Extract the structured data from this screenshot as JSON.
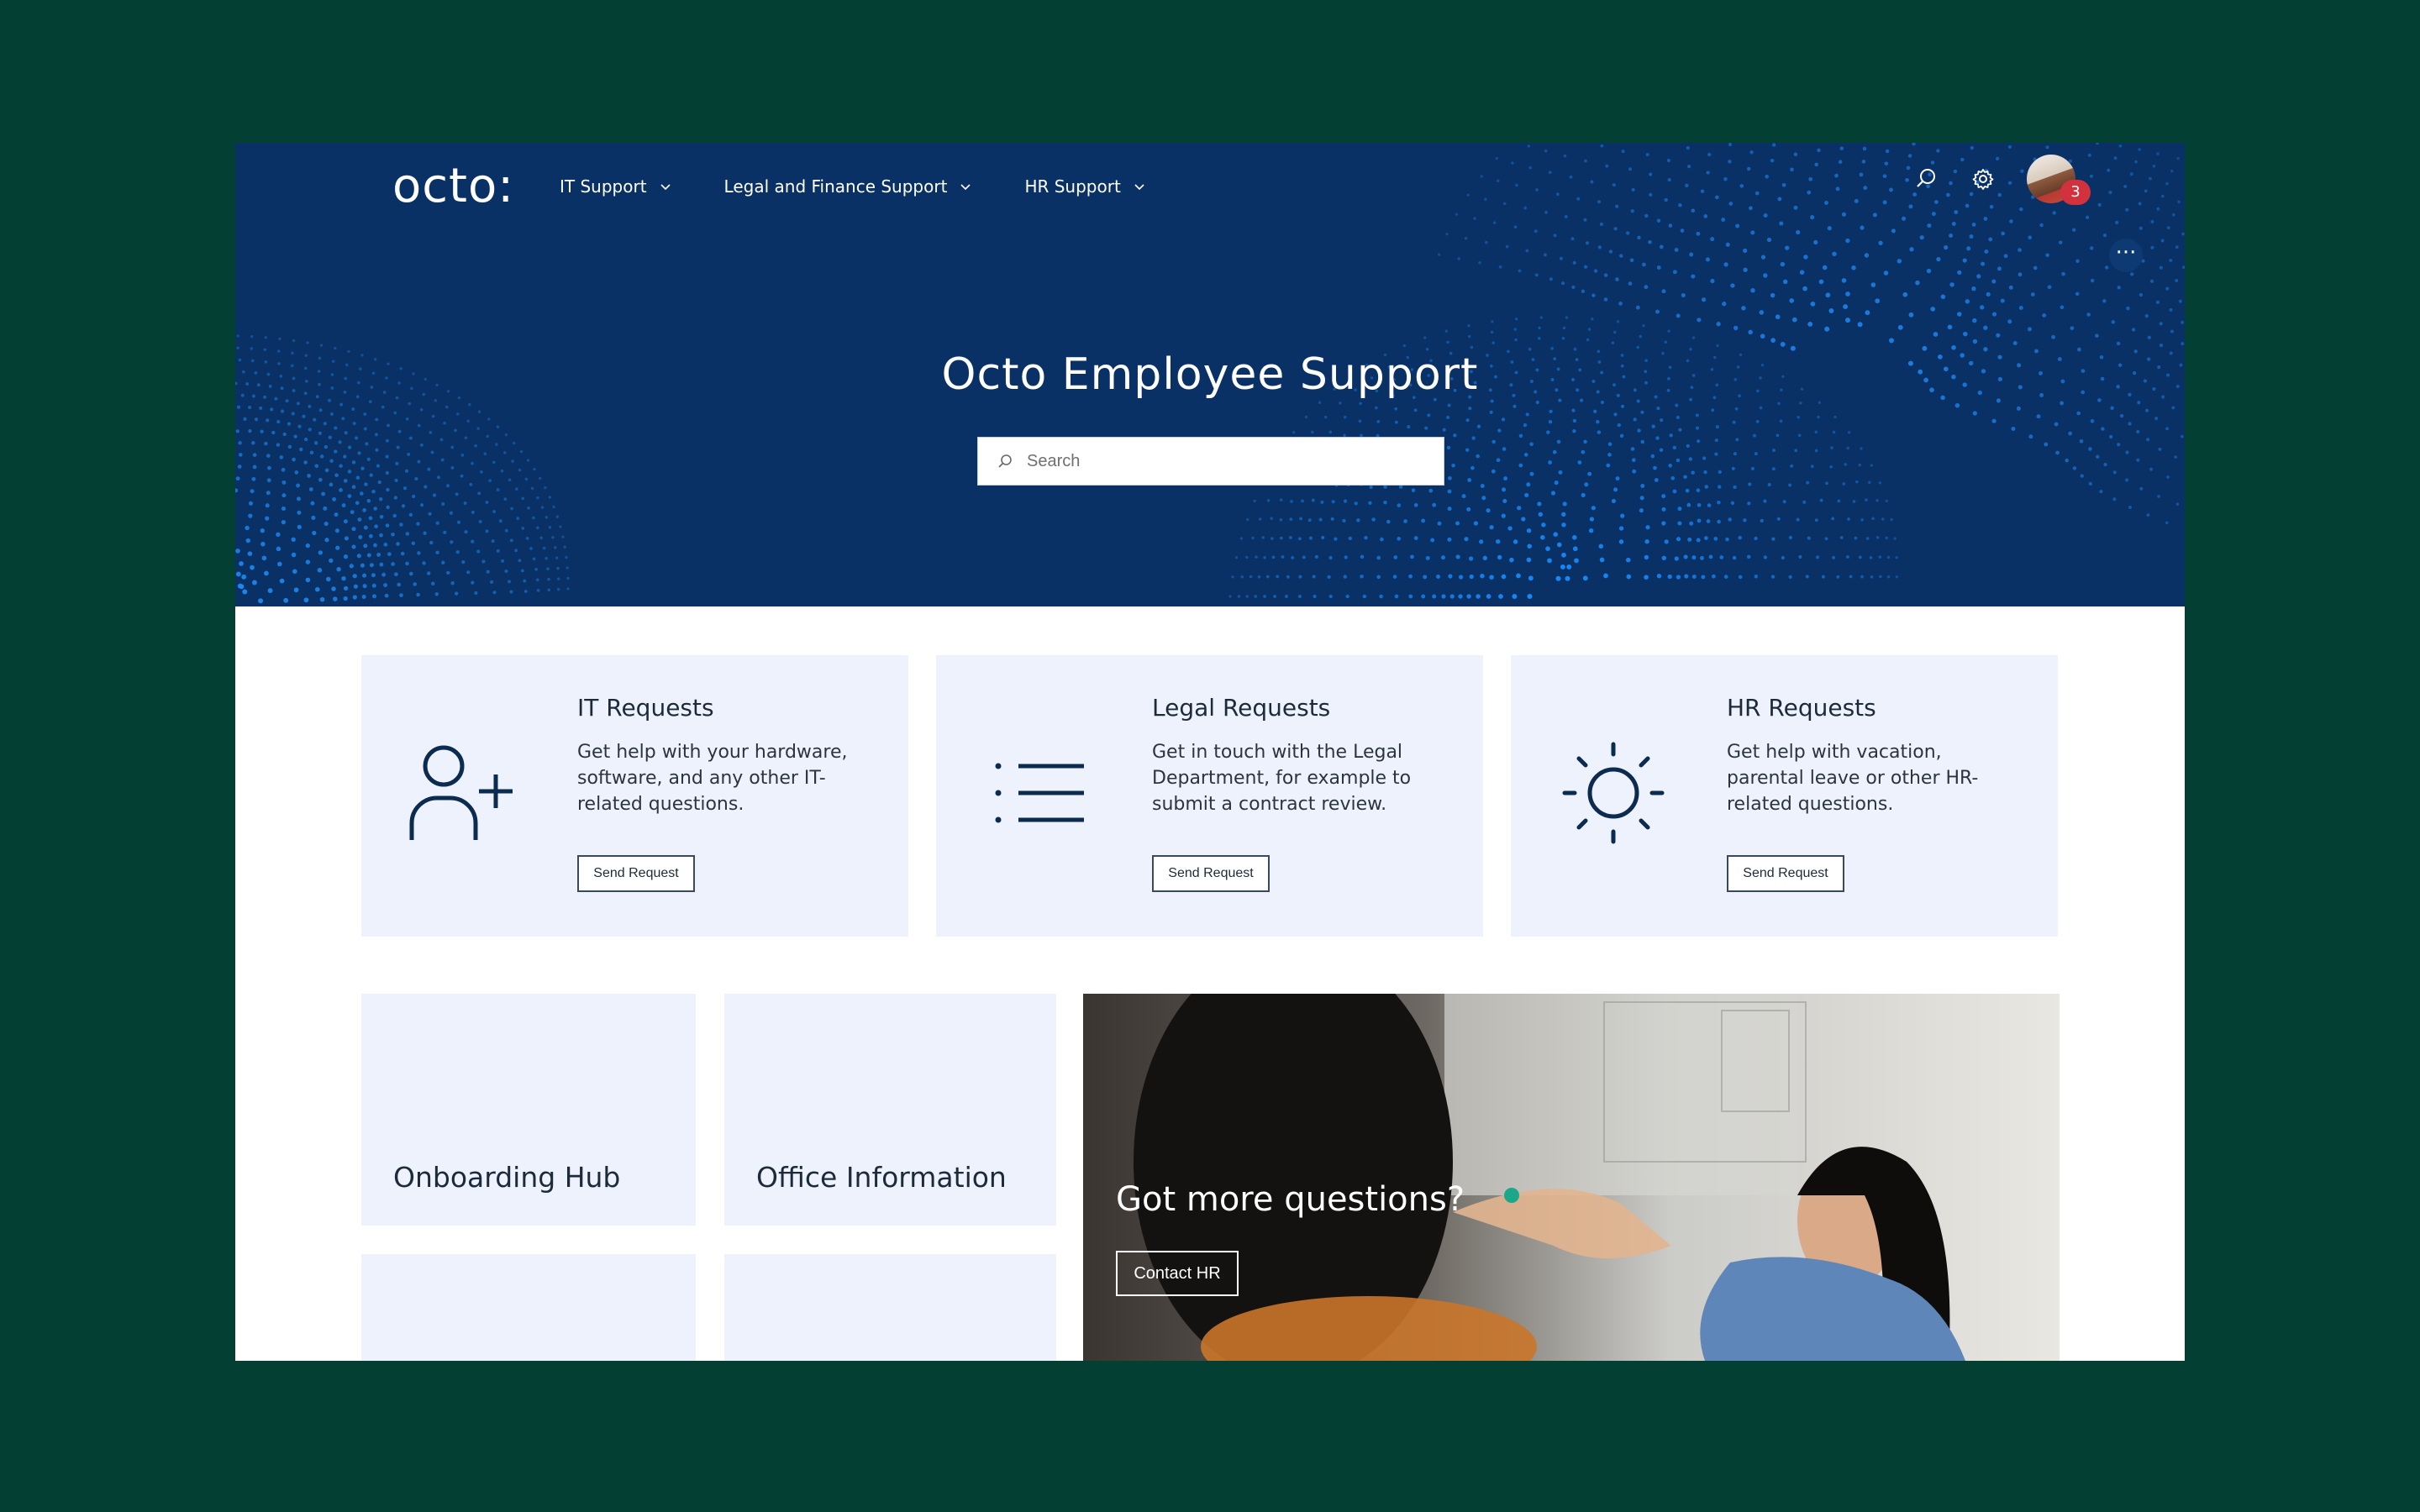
{
  "header": {
    "logo": "octo:",
    "nav": [
      {
        "label": "IT Support"
      },
      {
        "label": "Legal and Finance Support"
      },
      {
        "label": "HR Support"
      }
    ],
    "notification_count": "3",
    "more_label": "···"
  },
  "hero": {
    "title": "Octo Employee Support",
    "search_placeholder": "Search"
  },
  "cards": [
    {
      "title": "IT Requests",
      "description": "Get help with your hardware, software, and any other IT-related questions.",
      "button": "Send Request",
      "icon": "add-user-icon"
    },
    {
      "title": "Legal Requests",
      "description": "Get in touch with the Legal Department, for example to submit a contract review.",
      "button": "Send Request",
      "icon": "list-icon"
    },
    {
      "title": "HR Requests",
      "description": "Get help with vacation, parental leave or other HR-related questions.",
      "button": "Send Request",
      "icon": "sun-icon"
    }
  ],
  "tiles": [
    {
      "title": "Onboarding Hub"
    },
    {
      "title": "Office Information"
    },
    {
      "title": ""
    },
    {
      "title": ""
    }
  ],
  "promo": {
    "title": "Got more questions?",
    "button": "Contact HR"
  },
  "colors": {
    "page_background": "#043f33",
    "hero_background": "#0a3165",
    "card_background": "#eef2fd",
    "badge": "#d2323d"
  }
}
